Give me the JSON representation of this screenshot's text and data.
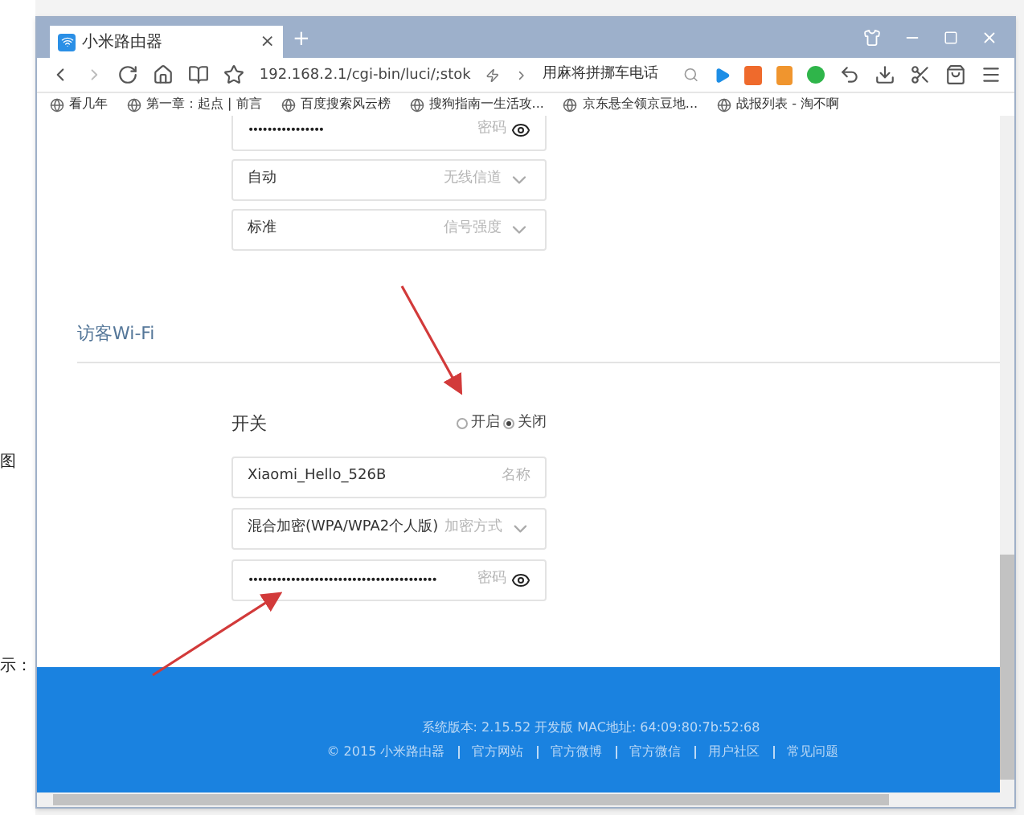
{
  "background_window": {
    "texts": [
      "图",
      "示："
    ]
  },
  "browser": {
    "tab": {
      "title": "小米路由器",
      "close": "×"
    },
    "new_tab": "+",
    "address": "192.168.2.1/cgi-bin/luci/;stok",
    "search": "用麻将拼挪车电话"
  },
  "bookmarks": [
    {
      "label": "看几年"
    },
    {
      "label": "第一章：起点 | 前言"
    },
    {
      "label": "百度搜索风云榜"
    },
    {
      "label": "搜狗指南一生活攻..."
    },
    {
      "label": "京东悬全领京豆地..."
    },
    {
      "label": "战报列表 - 淘不啊"
    }
  ],
  "wireless_fields": [
    {
      "kind": "password",
      "value": "••••••••••••••••",
      "label": "密码"
    },
    {
      "kind": "select",
      "value": "自动",
      "label": "无线信道"
    },
    {
      "kind": "select",
      "value": "标准",
      "label": "信号强度"
    }
  ],
  "guest_wifi": {
    "title": "访客Wi-Fi",
    "switch_label": "开关",
    "options": [
      {
        "label": "开启",
        "selected": false
      },
      {
        "label": "关闭",
        "selected": true
      }
    ],
    "fields": [
      {
        "kind": "text",
        "value": "Xiaomi_Hello_526B",
        "label": "名称"
      },
      {
        "kind": "select",
        "value": "混合加密(WPA/WPA2个人版)",
        "label": "加密方式"
      },
      {
        "kind": "password",
        "value": "••••••••••••••••••••••••••••••••••••••••",
        "label": "密码"
      }
    ]
  },
  "footer": {
    "version": "系统版本: 2.15.52 开发版   MAC地址: 64:09:80:7b:52:68",
    "links": [
      "© 2015 小米路由器",
      "官方网站",
      "官方微博",
      "官方微信",
      "用户社区",
      "常见问题"
    ]
  }
}
